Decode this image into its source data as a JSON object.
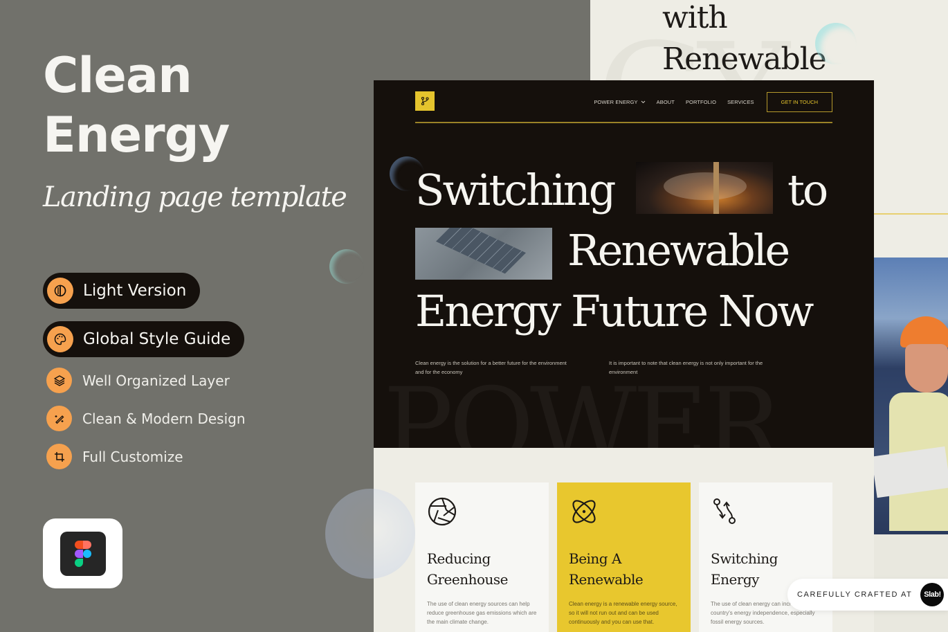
{
  "promo": {
    "title_line1": "Clean",
    "title_line2": "Energy",
    "subtitle": "Landing page template",
    "pills": [
      {
        "label": "Light Version",
        "icon": "contrast-icon"
      },
      {
        "label": "Global Style Guide",
        "icon": "palette-icon"
      }
    ],
    "features": [
      {
        "label": "Well Organized Layer",
        "icon": "layers-icon"
      },
      {
        "label": "Clean & Modern Design",
        "icon": "magic-wand-icon"
      },
      {
        "label": "Full Customize",
        "icon": "crop-icon"
      }
    ],
    "tool_icon": "figma-icon"
  },
  "background_preview": {
    "headline_line1": "with",
    "headline_line2": "Renewable",
    "ghost_text": "GY"
  },
  "preview": {
    "logo_icon": "git-branch-icon",
    "nav": {
      "items": [
        {
          "label": "POWER ENERGY",
          "has_dropdown": true
        },
        {
          "label": "ABOUT"
        },
        {
          "label": "PORTFOLIO"
        },
        {
          "label": "SERVICES"
        }
      ],
      "cta": "GET IN TOUCH"
    },
    "hero": {
      "line1_a": "Switching",
      "line1_b": "to",
      "line2": "Renewable",
      "line3": "Energy Future Now",
      "para1": "Clean energy is the solution for a better future for the environment and for the economy",
      "para2": "It is important to note that clean energy is not only important for the environment",
      "ghost_text": "POWER"
    },
    "cards": [
      {
        "icon": "aperture-icon",
        "title_line1": "Reducing",
        "title_line2": "Greenhouse",
        "text": "The use of clean energy sources can help reduce greenhouse gas emissions which are the main climate change.",
        "highlighted": false
      },
      {
        "icon": "atom-icon",
        "title_line1": "Being A",
        "title_line2": "Renewable",
        "text": "Clean energy is a renewable energy source, so it will not run out and can be used continuously and you can use that.",
        "highlighted": true
      },
      {
        "icon": "switch-arrows-icon",
        "title_line1": "Switching",
        "title_line2": "Energy",
        "text": "The use of clean energy can increase a country's energy independence, especially fossil energy sources.",
        "highlighted": false
      }
    ]
  },
  "badge": {
    "text": "CAREFULLY CRAFTED AT",
    "brand": "Slab!"
  },
  "colors": {
    "promo_bg": "#71716b",
    "accent_orange": "#f6a14e",
    "accent_yellow": "#e8c72e",
    "dark": "#15100c",
    "light_bg": "#eeede5"
  }
}
